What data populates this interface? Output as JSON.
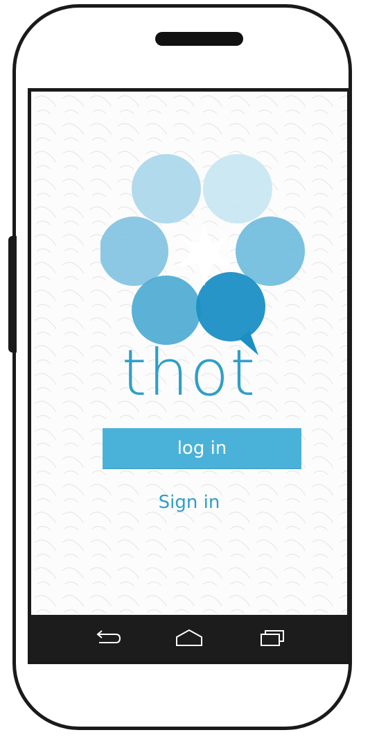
{
  "app": {
    "brand_name": "thot",
    "login_label": "log in",
    "signin_label": "Sign in"
  },
  "colors": {
    "accent": "#2f9fc8",
    "button": "#4ab2d9",
    "navbar": "#1c1c1c",
    "frame": "#1a1a1a"
  },
  "navbar": {
    "icons": [
      "back-icon",
      "home-icon",
      "recent-apps-icon"
    ]
  }
}
